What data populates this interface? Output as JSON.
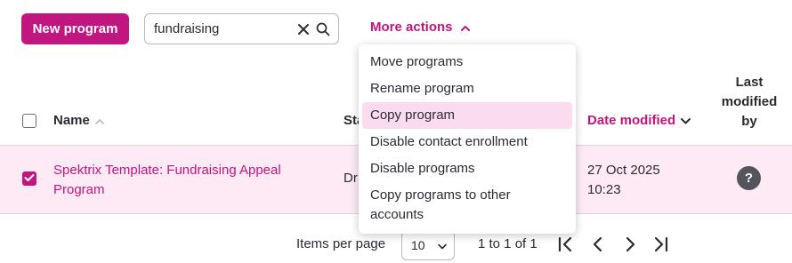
{
  "toolbar": {
    "new_program_label": "New program",
    "search_value": "fundraising",
    "more_actions_label": "More actions"
  },
  "table": {
    "headers": {
      "name": "Name",
      "status": "Sta",
      "date_modified": "Date modified",
      "last_modified_by": [
        "Last",
        "modified",
        "by"
      ]
    },
    "rows": [
      {
        "selected": true,
        "name": [
          "Spektrix Template: Fundraising Appeal",
          "Program"
        ],
        "status": "Dr",
        "date_modified": [
          "27 Oct 2025",
          "10:23"
        ],
        "last_modified_by": "?"
      }
    ]
  },
  "pagination": {
    "items_per_page_label": "Items per page",
    "items_per_page_value": "10",
    "range_text": "1 to 1 of 1"
  },
  "menu": {
    "items": [
      [
        "Move programs"
      ],
      [
        "Rename program"
      ],
      [
        "Copy program"
      ],
      [
        "Disable contact enrollment"
      ],
      [
        "Disable programs"
      ],
      [
        "Copy programs to other",
        "accounts"
      ]
    ],
    "highlighted_index": 2
  },
  "colors": {
    "brand": "#c1157f",
    "row_selected_bg": "#fdeaf4",
    "menu_highlight_bg": "#fbdcee"
  }
}
